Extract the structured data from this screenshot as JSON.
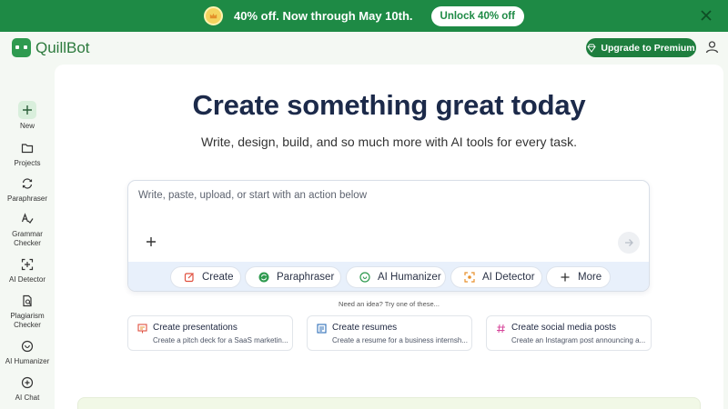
{
  "promo": {
    "text": "40% off. Now through May 10th.",
    "button": "Unlock 40% off"
  },
  "header": {
    "logo_text": "QuillBot",
    "upgrade_label": "Upgrade to Premium"
  },
  "sidebar": {
    "items": [
      {
        "label": "New",
        "icon": "plus-icon"
      },
      {
        "label": "Projects",
        "icon": "folder-icon"
      },
      {
        "label": "Paraphraser",
        "icon": "paraphraser-icon"
      },
      {
        "label": "Grammar Checker",
        "icon": "grammar-icon"
      },
      {
        "label": "AI Detector",
        "icon": "detector-icon"
      },
      {
        "label": "Plagiarism Checker",
        "icon": "plagiarism-icon"
      },
      {
        "label": "AI Humanizer",
        "icon": "humanizer-icon"
      },
      {
        "label": "AI Chat",
        "icon": "chat-icon"
      }
    ]
  },
  "main": {
    "title": "Create something great today",
    "subtitle": "Write, design, build, and so much more with AI tools for every task.",
    "composer_placeholder": "Write, paste, upload, or start with an action below",
    "actions": [
      {
        "label": "Create",
        "icon": "create-icon"
      },
      {
        "label": "Paraphraser",
        "icon": "paraphraser-icon"
      },
      {
        "label": "AI Humanizer",
        "icon": "humanizer-icon"
      },
      {
        "label": "AI Detector",
        "icon": "detector-icon"
      },
      {
        "label": "More",
        "icon": "plus-icon"
      }
    ],
    "idea_text": "Need an idea? Try one of these...",
    "suggestions": [
      {
        "title": "Create presentations",
        "subtitle": "Create a pitch deck for a SaaS marketin...",
        "icon": "presentation-icon"
      },
      {
        "title": "Create resumes",
        "subtitle": "Create a resume for a business internsh...",
        "icon": "resume-icon"
      },
      {
        "title": "Create social media posts",
        "subtitle": "Create an Instagram post announcing a...",
        "icon": "hashtag-icon"
      }
    ]
  },
  "colors": {
    "brand_green": "#1e8a45",
    "title_navy": "#1c2a4a",
    "action_bar": "#e8f0fb"
  }
}
